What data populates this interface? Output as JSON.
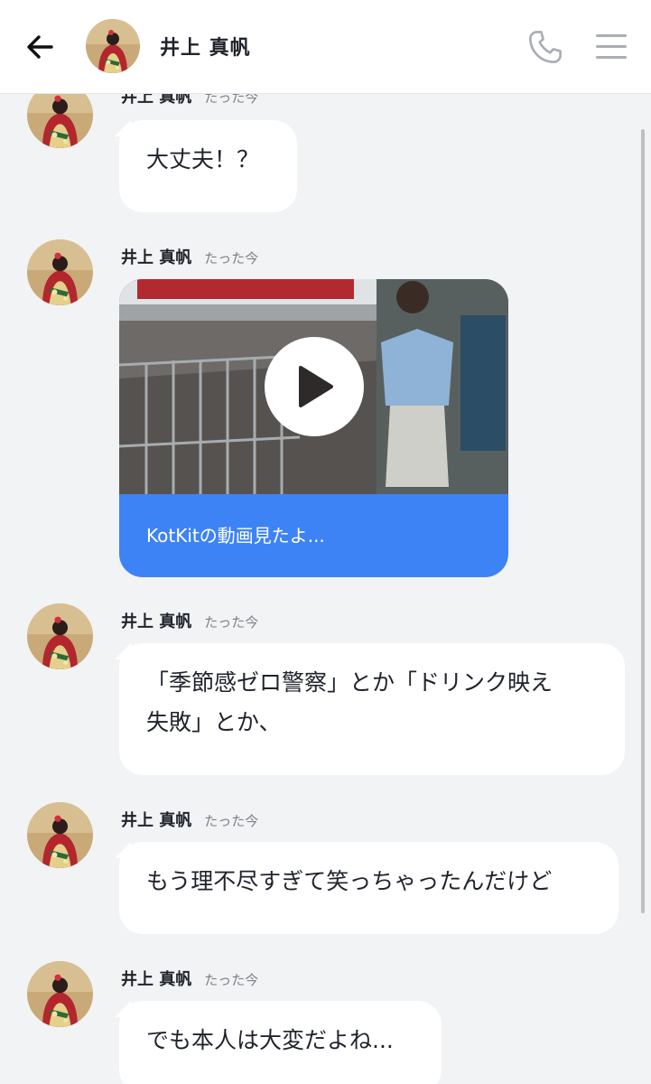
{
  "header": {
    "title": "井上 真帆",
    "back_icon": "arrow-left-icon",
    "call_icon": "phone-icon",
    "menu_icon": "hamburger-menu-icon"
  },
  "colors": {
    "background": "#f2f3f5",
    "bubble": "#ffffff",
    "video_caption_bg": "#3d83f6",
    "header_icons": "#a9adb4"
  },
  "messages": [
    {
      "sender": "井上 真帆",
      "time": "たった今",
      "text": "大丈夫！？"
    },
    {
      "sender": "井上 真帆",
      "time": "たった今",
      "type": "video",
      "caption": "KotKitの動画見たよ...",
      "icon": "play-icon"
    },
    {
      "sender": "井上 真帆",
      "time": "たった今",
      "text_lines": [
        "「季節感ゼロ警察」とか「ドリンク映え",
        "失敗」とか、"
      ]
    },
    {
      "sender": "井上 真帆",
      "time": "たった今",
      "text": "もう理不尽すぎて笑っちゃったんだけど"
    },
    {
      "sender": "井上 真帆",
      "time": "たった今",
      "text": "でも本人は大変だよね..."
    }
  ]
}
